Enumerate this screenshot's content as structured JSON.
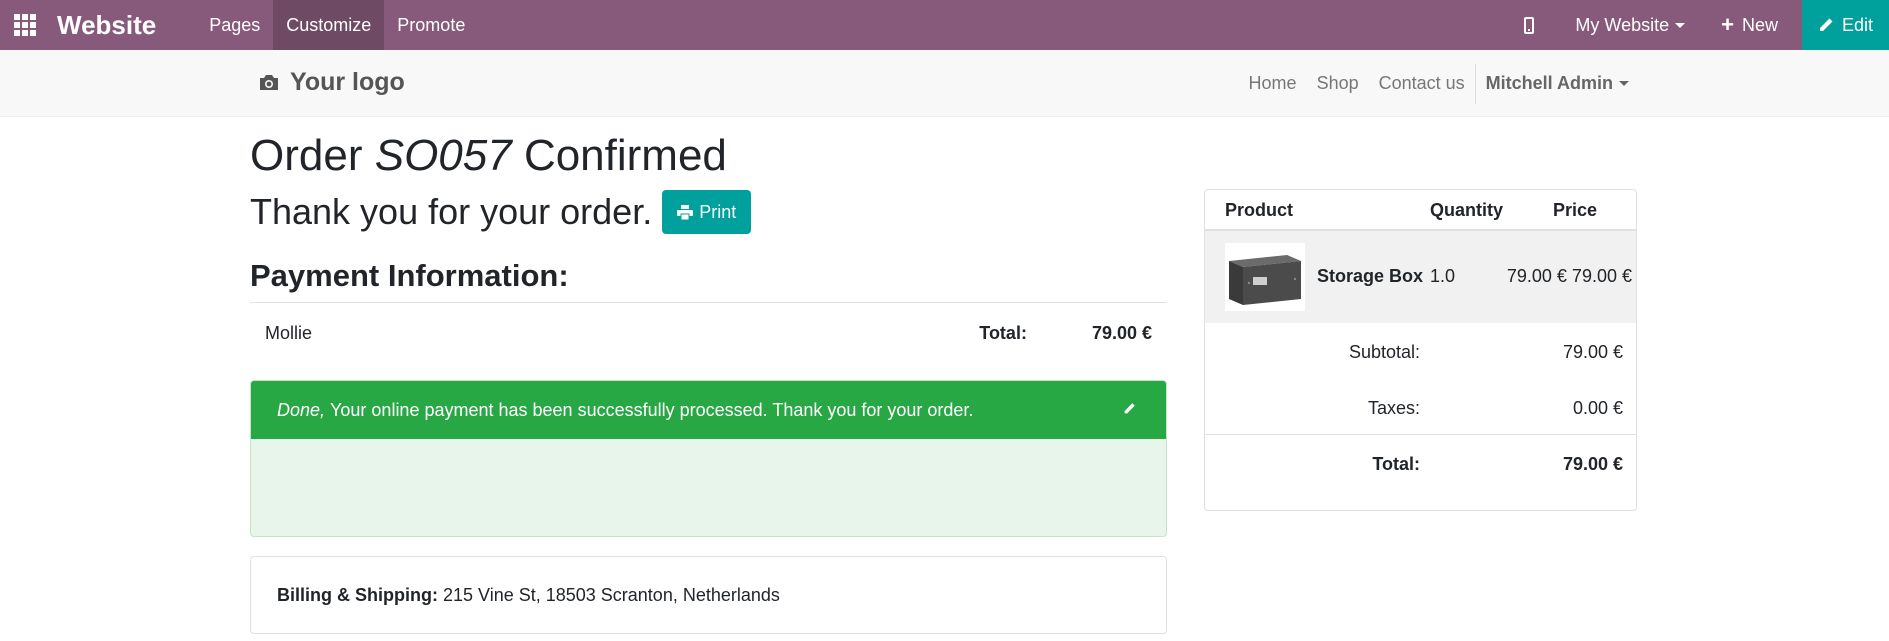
{
  "topbar": {
    "brand": "Website",
    "menu": [
      "Pages",
      "Customize",
      "Promote"
    ],
    "website_switcher": "My Website",
    "new_label": "New",
    "edit_label": "Edit",
    "bg_color": "#875a7b",
    "edit_color": "#00a09d"
  },
  "header": {
    "logo_text": "Your logo",
    "nav": [
      "Home",
      "Shop",
      "Contact us"
    ],
    "user": "Mitchell Admin"
  },
  "order": {
    "title_prefix": "Order",
    "number": "SO057",
    "title_suffix": "Confirmed",
    "thanks": "Thank you for your order.",
    "print_label": "Print"
  },
  "payment": {
    "heading": "Payment Information:",
    "method": "Mollie",
    "total_label": "Total:",
    "total_value": "79.00 €",
    "alert_done": "Done,",
    "alert_message": "Your online payment has been successfully processed. Thank you for your order."
  },
  "billing": {
    "label": "Billing & Shipping:",
    "address": "215 Vine St, 18503 Scranton, Netherlands"
  },
  "summary": {
    "headers": {
      "product": "Product",
      "quantity": "Quantity",
      "price": "Price"
    },
    "item": {
      "name": "Storage Box",
      "quantity": "1.0",
      "price": "79.00 € 79.00 €",
      "image": "storage-box-product-image"
    },
    "subtotal_label": "Subtotal:",
    "subtotal_value": "79.00 €",
    "taxes_label": "Taxes:",
    "taxes_value": "0.00 €",
    "total_label": "Total:",
    "total_value": "79.00 €"
  }
}
